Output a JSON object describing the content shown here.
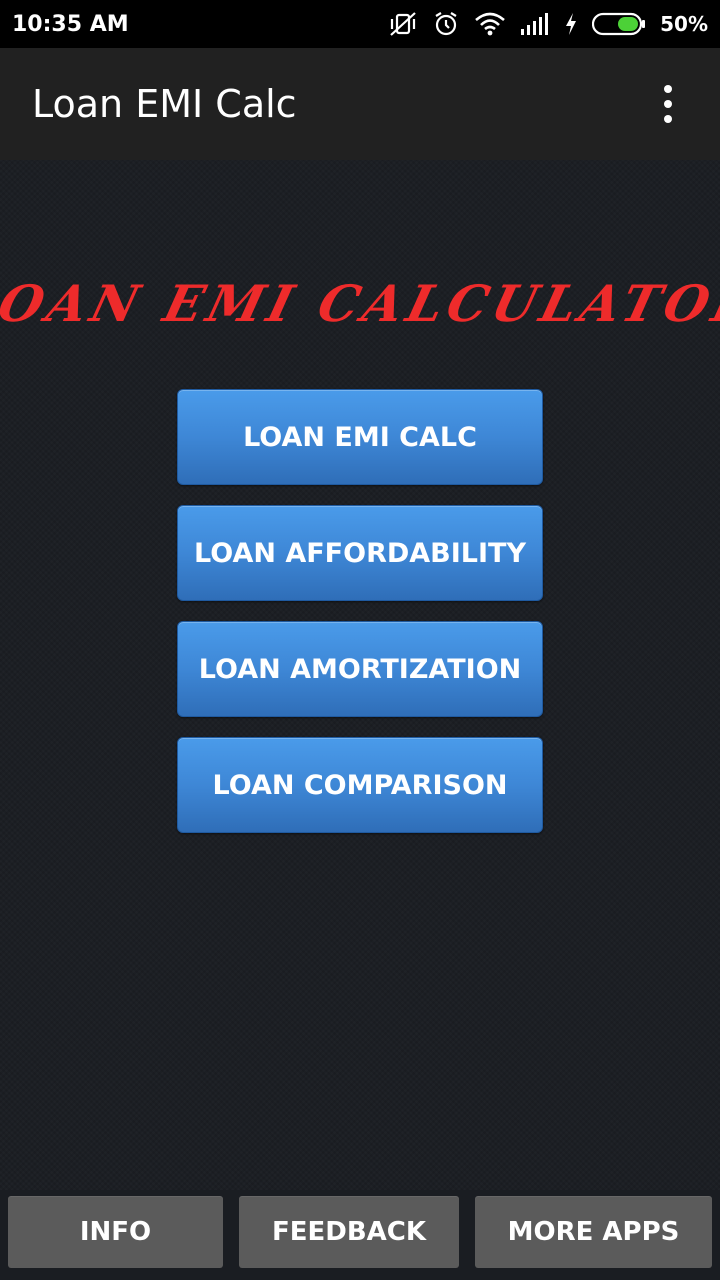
{
  "status_bar": {
    "time": "10:35 AM",
    "battery_percent": "50%",
    "icons": [
      "vibrate-off-icon",
      "alarm-icon",
      "wifi-icon",
      "signal-icon",
      "charging-icon",
      "battery-icon"
    ]
  },
  "app_bar": {
    "title": "Loan EMI Calc",
    "menu_icon": "overflow-menu-icon"
  },
  "banner": {
    "text": "LOAN EMI CALCULATOR",
    "color": "#ee2b2b"
  },
  "menu": {
    "buttons": [
      {
        "label": "LOAN EMI CALC"
      },
      {
        "label": "LOAN AFFORDABILITY"
      },
      {
        "label": "LOAN AMORTIZATION"
      },
      {
        "label": "LOAN COMPARISON"
      }
    ],
    "accent": "#3e87d6"
  },
  "bottom_bar": {
    "info_label": "INFO",
    "feedback_label": "FEEDBACK",
    "more_apps_label": "MORE APPS"
  }
}
